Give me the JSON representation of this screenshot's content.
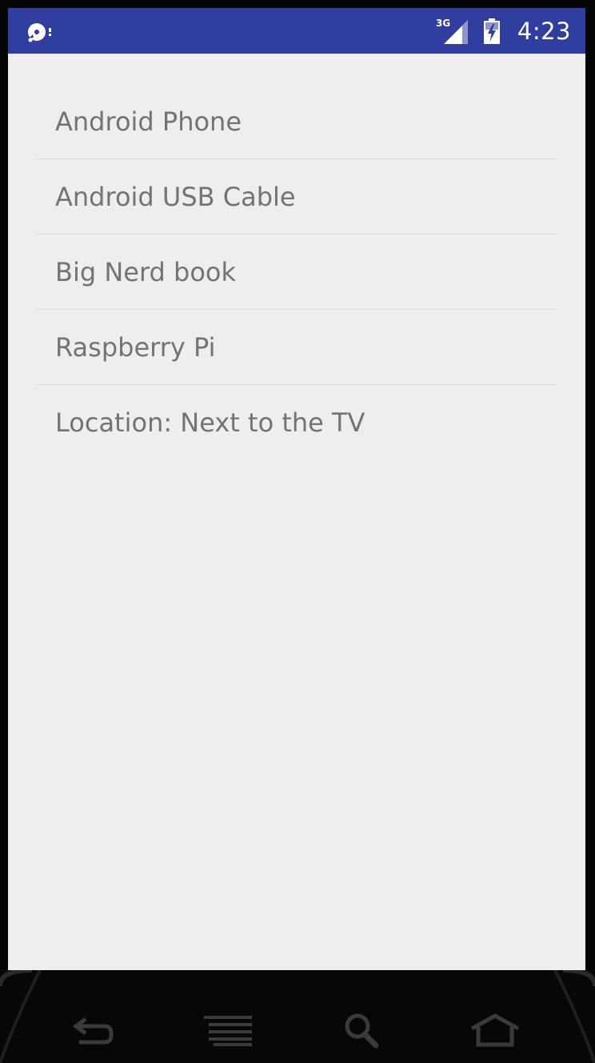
{
  "status_bar": {
    "time": "4:23",
    "network_label": "3G",
    "left_icon": "disc-icon",
    "signal_icon": "cellular-signal-icon",
    "battery_icon": "battery-charging-icon",
    "background_color": "#303f9f"
  },
  "list": {
    "items": [
      {
        "label": "Android Phone"
      },
      {
        "label": "Android USB Cable"
      },
      {
        "label": "Big Nerd book"
      },
      {
        "label": "Raspberry Pi"
      },
      {
        "label": "Location: Next to the TV"
      }
    ]
  },
  "nav_bar": {
    "buttons": [
      {
        "icon": "back-icon"
      },
      {
        "icon": "menu-icon"
      },
      {
        "icon": "search-icon"
      },
      {
        "icon": "home-icon"
      }
    ]
  }
}
